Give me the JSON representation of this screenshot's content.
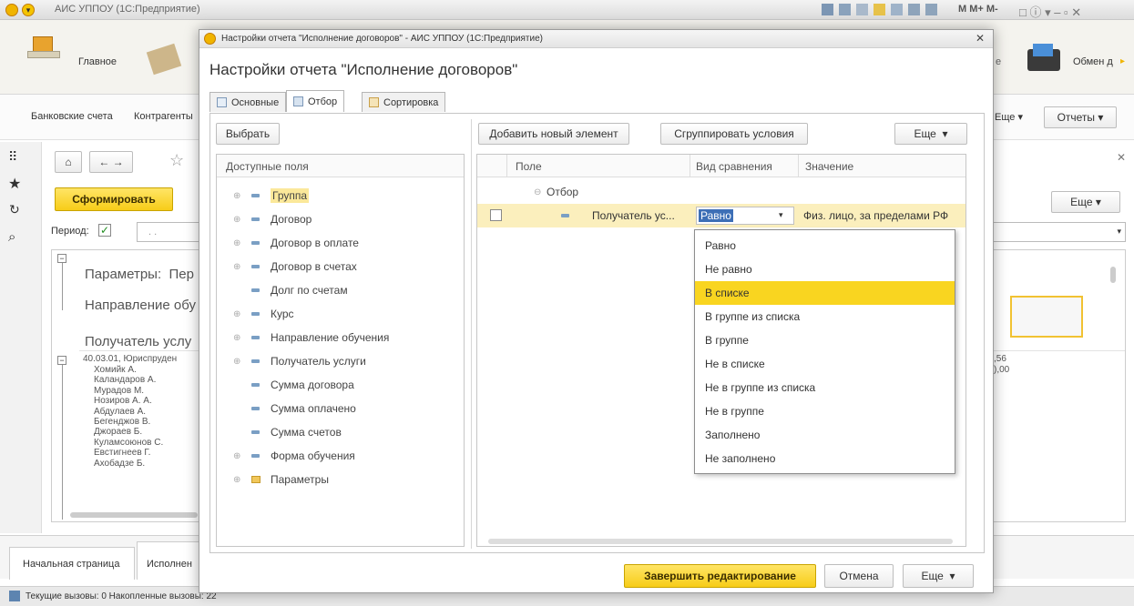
{
  "app": {
    "title": "АИС УППОУ (1С:Предприятие)",
    "mm": "M M+ M-"
  },
  "sections": {
    "home": "Главное",
    "exchange": "Обмен д"
  },
  "nav": {
    "bank": "Банковские счета",
    "contractors": "Контрагенты",
    "more": "Еще",
    "reports": "Отчеты"
  },
  "report": {
    "generate": "Сформировать",
    "more": "Еще",
    "period_label": "Период:",
    "period_value": ". .",
    "params": "Параметры:",
    "params_tail": "Пер",
    "direction": "Направление обу",
    "recipient": "Получатель услу",
    "group_row": "40.03.01, Юриспруден",
    "persons": [
      "Хомийк А.",
      "Каландаров А.",
      "Мурадов М.",
      "Нозиров А. А.",
      "Абдулаев А.",
      "Бегенджов В.",
      "Джораев Б.",
      "Куламсоюнов С.",
      "Евстигнеев Г.",
      "Ахобадзе Б."
    ],
    "val1": ",56",
    "val2": "),00"
  },
  "bottom_tabs": [
    "Начальная страница",
    "Исполнен"
  ],
  "status": "Текущие вызовы: 0  Накопленные вызовы: 22",
  "dialog": {
    "window_title": "Настройки отчета \"Исполнение договоров\" - АИС УППОУ (1С:Предприятие)",
    "heading": "Настройки отчета \"Исполнение договоров\"",
    "tabs": [
      "Основные",
      "Отбор",
      "Сортировка"
    ],
    "select_btn": "Выбрать",
    "fields_header": "Доступные поля",
    "fields": [
      "Группа",
      "Договор",
      "Договор в оплате",
      "Договор в счетах",
      "Долг по счетам",
      "Курс",
      "Направление обучения",
      "Получатель услуги",
      "Сумма договора",
      "Сумма оплачено",
      "Сумма счетов",
      "Форма обучения",
      "Параметры"
    ],
    "add_btn": "Добавить новый элемент",
    "group_btn": "Сгруппировать условия",
    "more": "Еще",
    "cols": {
      "field": "Поле",
      "cmp": "Вид сравнения",
      "value": "Значение"
    },
    "filter_root": "Отбор",
    "filter_row": {
      "field": "Получатель ус...",
      "cmp": "Равно",
      "value": "Физ. лицо, за пределами РФ"
    },
    "dropdown": [
      "Равно",
      "Не равно",
      "В списке",
      "В группе из списка",
      "В группе",
      "Не в списке",
      "Не в группе из списка",
      "Не в группе",
      "Заполнено",
      "Не заполнено"
    ],
    "finish_btn": "Завершить редактирование",
    "cancel_btn": "Отмена"
  }
}
